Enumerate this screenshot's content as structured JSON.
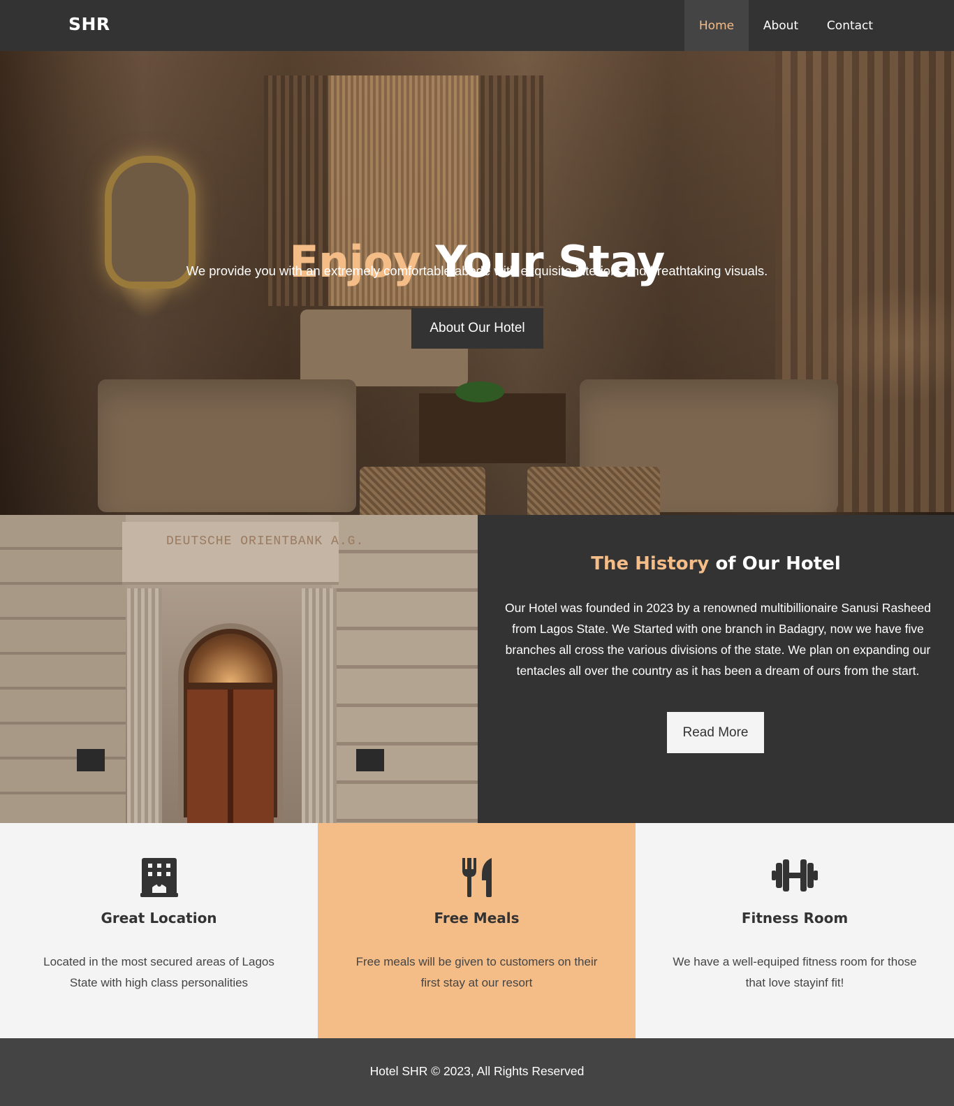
{
  "header": {
    "brand": "SHR",
    "nav": [
      {
        "label": "Home",
        "active": true
      },
      {
        "label": "About",
        "active": false
      },
      {
        "label": "Contact",
        "active": false
      }
    ]
  },
  "hero": {
    "title_accent": "Enjoy",
    "title_rest": "Your Stay",
    "subtitle": "We provide you with an extremely comfortable abode with exquisite interiors and breathtaking visuals.",
    "button_label": "About Our Hotel"
  },
  "history": {
    "image_sign_text": "DEUTSCHE ORIENTBANK A.G.",
    "title_accent": "The History",
    "title_rest": "of Our Hotel",
    "text": "Our Hotel was founded in 2023 by a renowned multibillionaire Sanusi Rasheed from Lagos State. We Started with one branch in Badagry, now we have five branches all cross the various divisions of the state. We plan on expanding our tentacles all over the country as it has been a dream of ours from the start.",
    "button_label": "Read More"
  },
  "features": [
    {
      "icon": "building-icon",
      "title": "Great Location",
      "text": "Located in the most secured areas of Lagos State with high class personalities"
    },
    {
      "icon": "utensils-icon",
      "title": "Free Meals",
      "text": "Free meals will be given to customers on their first stay at our resort"
    },
    {
      "icon": "dumbbell-icon",
      "title": "Fitness Room",
      "text": "We have a well-equiped fitness room for those that love stayinf fit!"
    }
  ],
  "footer": {
    "text": "Hotel SHR © 2023, All Rights Reserved"
  },
  "colors": {
    "dark": "#333333",
    "accent": "#f4bd88",
    "light": "#f4f4f4",
    "footer": "#444444"
  }
}
